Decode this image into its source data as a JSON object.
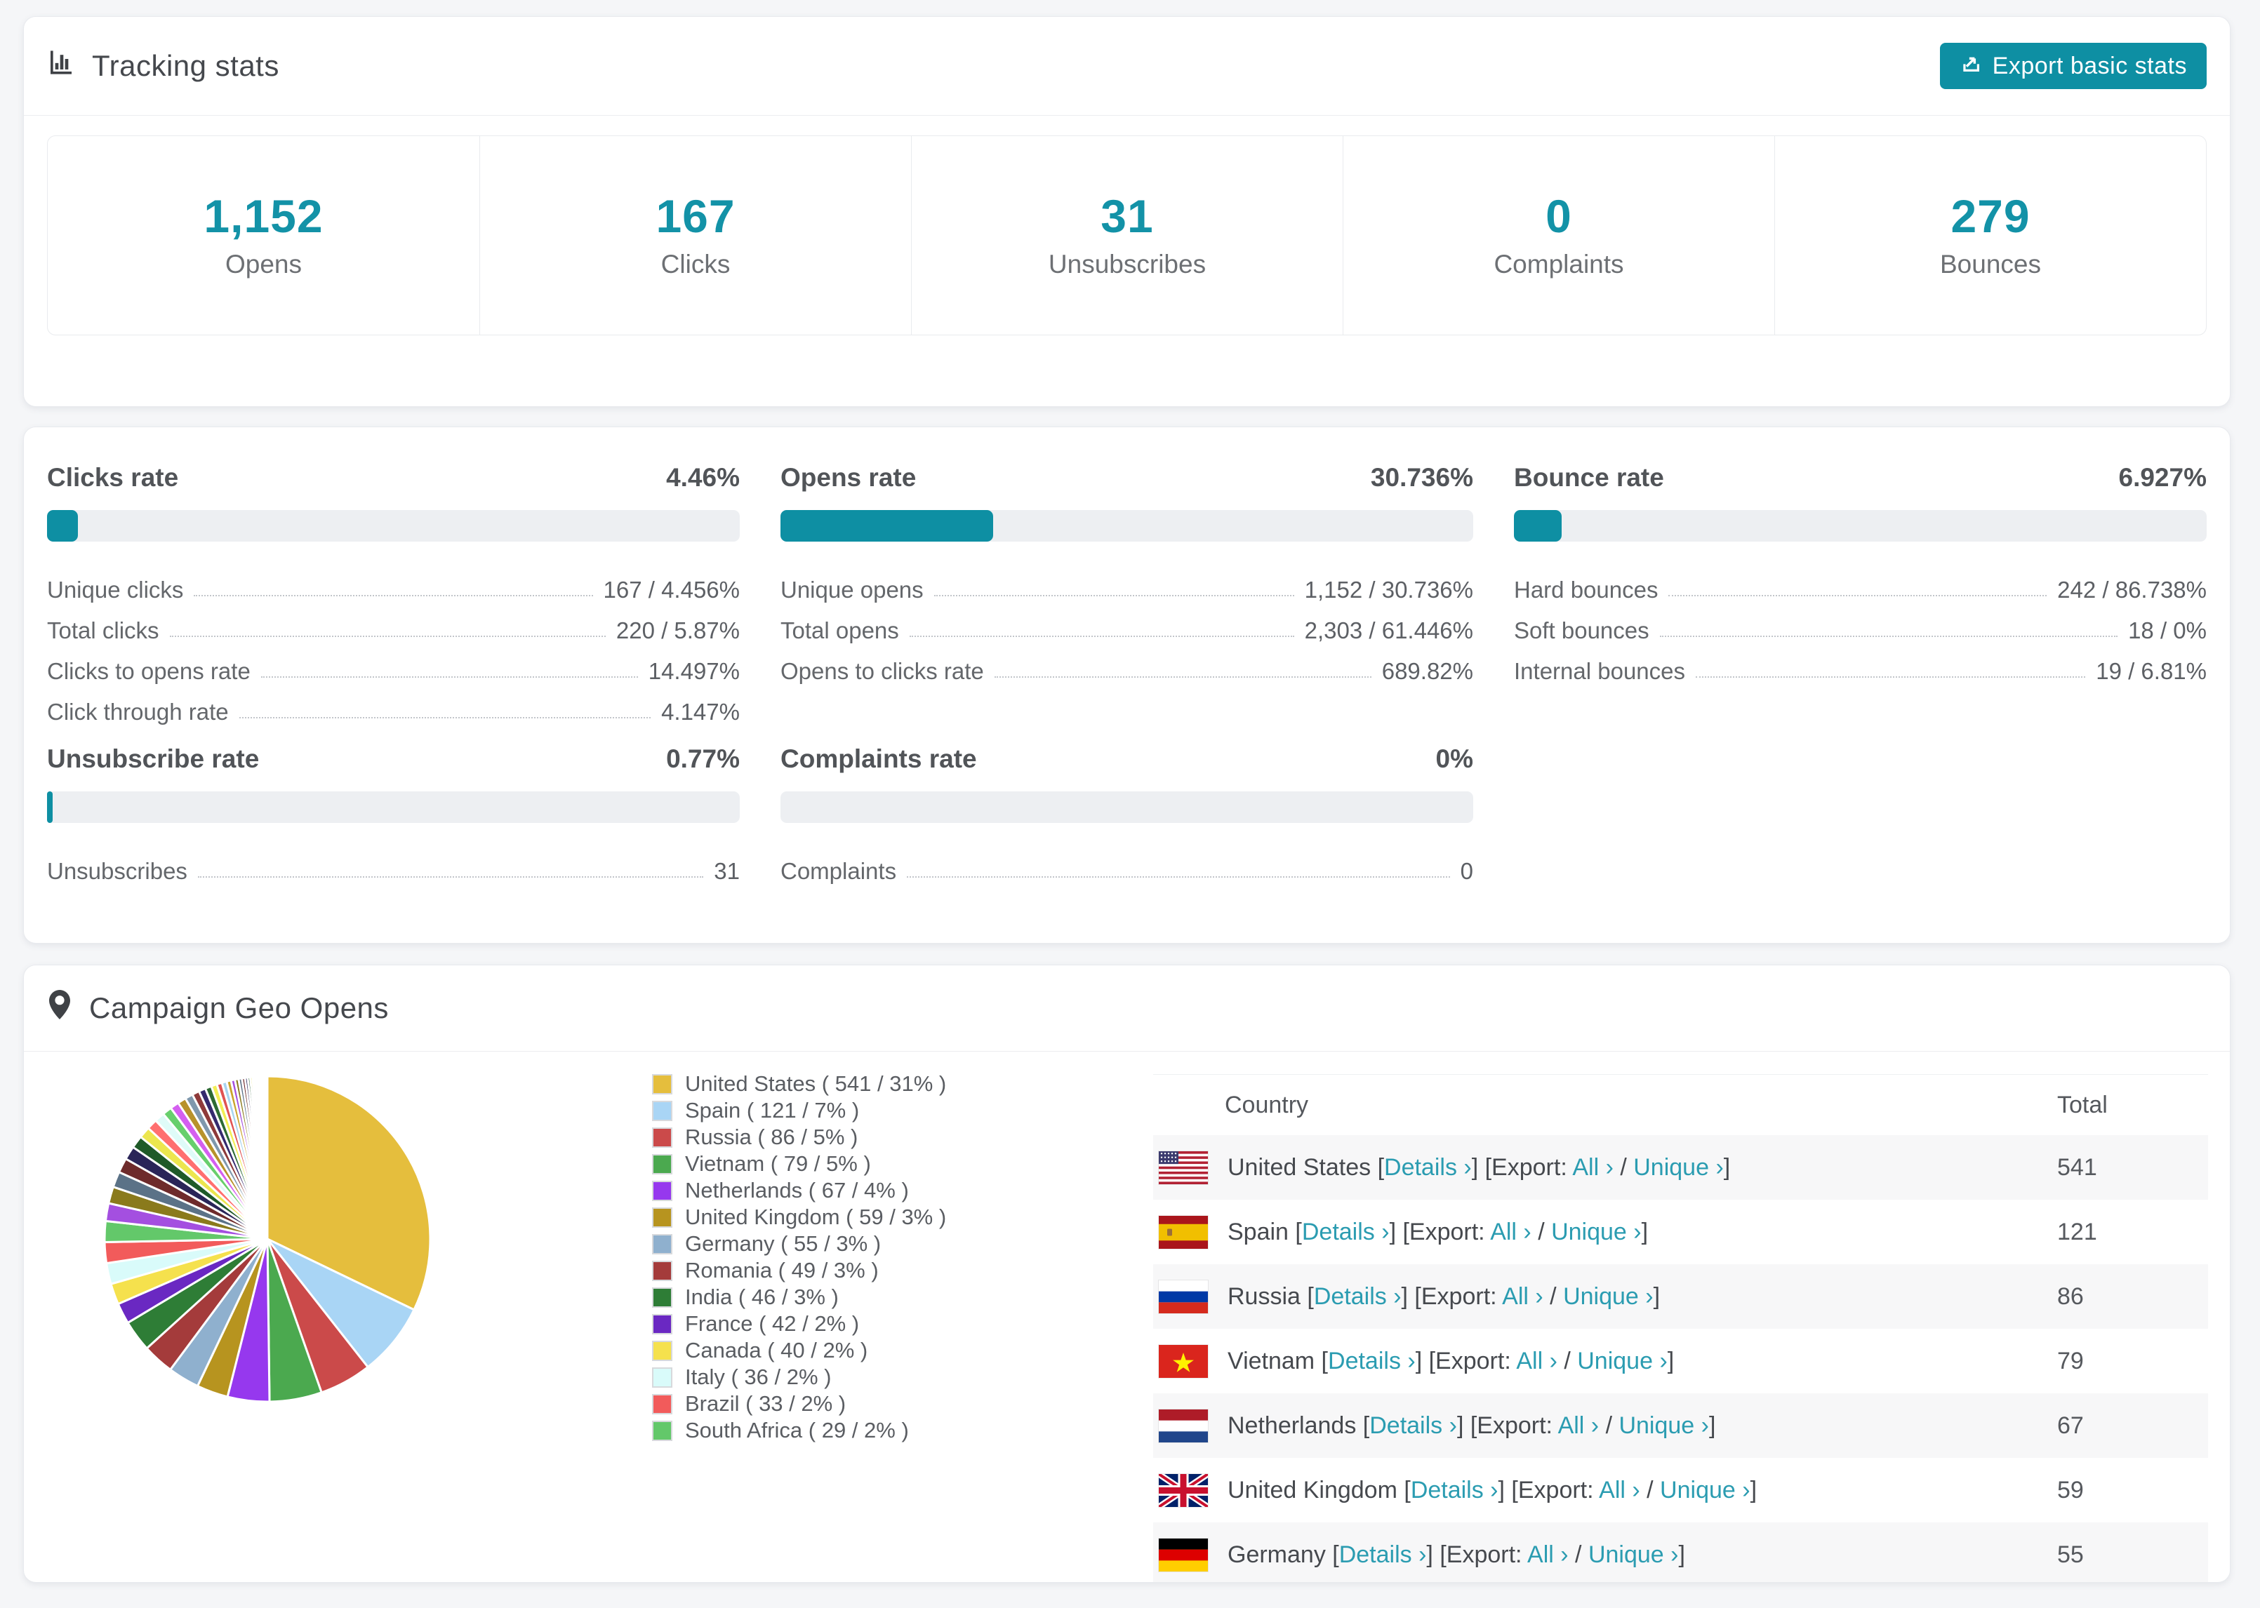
{
  "page": {
    "background": "#f5f6f8"
  },
  "colors": {
    "accent": "#0e8fa3",
    "stat_number": "#1392a7",
    "link": "#2b9cb1",
    "bar_track": "#edeff2",
    "card_border": "#e8eaee"
  },
  "tracking": {
    "title": "Tracking stats",
    "export_label": "Export basic stats",
    "summary": [
      {
        "value": "1,152",
        "label": "Opens"
      },
      {
        "value": "167",
        "label": "Clicks"
      },
      {
        "value": "31",
        "label": "Unsubscribes"
      },
      {
        "value": "0",
        "label": "Complaints"
      },
      {
        "value": "279",
        "label": "Bounces"
      }
    ]
  },
  "rates": [
    {
      "title": "Clicks rate",
      "percent": "4.46%",
      "bar_percent": 4.46,
      "rows": [
        {
          "label": "Unique clicks",
          "value": "167 / 4.456%"
        },
        {
          "label": "Total clicks",
          "value": "220 / 5.87%"
        },
        {
          "label": "Clicks to opens rate",
          "value": "14.497%"
        },
        {
          "label": "Click through rate",
          "value": "4.147%"
        }
      ]
    },
    {
      "title": "Opens rate",
      "percent": "30.736%",
      "bar_percent": 30.736,
      "rows": [
        {
          "label": "Unique opens",
          "value": "1,152 / 30.736%"
        },
        {
          "label": "Total opens",
          "value": "2,303 / 61.446%"
        },
        {
          "label": "Opens to clicks rate",
          "value": "689.82%"
        }
      ]
    },
    {
      "title": "Bounce rate",
      "percent": "6.927%",
      "bar_percent": 6.927,
      "rows": [
        {
          "label": "Hard bounces",
          "value": "242 / 86.738%"
        },
        {
          "label": "Soft bounces",
          "value": "18 / 0%"
        },
        {
          "label": "Internal bounces",
          "value": "19 / 6.81%"
        }
      ]
    },
    {
      "title": "Unsubscribe rate",
      "percent": "0.77%",
      "bar_percent": 0.77,
      "rows": [
        {
          "label": "Unsubscribes",
          "value": "31"
        }
      ]
    },
    {
      "title": "Complaints rate",
      "percent": "0%",
      "bar_percent": 0,
      "rows": [
        {
          "label": "Complaints",
          "value": "0"
        }
      ]
    }
  ],
  "geo": {
    "title": "Campaign Geo Opens",
    "chart_data": {
      "type": "pie",
      "title": "Campaign Geo Opens",
      "legend_position": "right",
      "start_angle_deg": -90,
      "direction": "clockwise",
      "slices": [
        {
          "label": "United States",
          "count": 541,
          "pct": 31,
          "color": "#E5BE3D"
        },
        {
          "label": "Spain",
          "count": 121,
          "pct": 7,
          "color": "#A9D5F5"
        },
        {
          "label": "Russia",
          "count": 86,
          "pct": 5,
          "color": "#CB4A4A"
        },
        {
          "label": "Vietnam",
          "count": 79,
          "pct": 5,
          "color": "#4BA94F"
        },
        {
          "label": "Netherlands",
          "count": 67,
          "pct": 4,
          "color": "#9638EE"
        },
        {
          "label": "United Kingdom",
          "count": 59,
          "pct": 3,
          "color": "#B7941F"
        },
        {
          "label": "Germany",
          "count": 55,
          "pct": 3,
          "color": "#8FB0CE"
        },
        {
          "label": "Romania",
          "count": 49,
          "pct": 3,
          "color": "#A43B3B"
        },
        {
          "label": "India",
          "count": 46,
          "pct": 3,
          "color": "#2E7D36"
        },
        {
          "label": "France",
          "count": 42,
          "pct": 2,
          "color": "#6A28C2"
        },
        {
          "label": "Canada",
          "count": 40,
          "pct": 2,
          "color": "#F5E14D"
        },
        {
          "label": "Italy",
          "count": 36,
          "pct": 2,
          "color": "#D9FBFA"
        },
        {
          "label": "Brazil",
          "count": 33,
          "pct": 2,
          "color": "#F25B5B"
        },
        {
          "label": "South Africa",
          "count": 29,
          "pct": 2,
          "color": "#63C86A"
        }
      ],
      "other_slices_percents": [
        1.7,
        1.6,
        1.5,
        1.4,
        1.3,
        1.2,
        1.1,
        1.0,
        0.95,
        0.9,
        0.85,
        0.8,
        0.75,
        0.7,
        0.65,
        0.6,
        0.55,
        0.5,
        0.46,
        0.42,
        0.38,
        0.35,
        0.32,
        0.29,
        0.26,
        0.24,
        0.22,
        0.2,
        0.18,
        0.16,
        0.14,
        0.12,
        0.11,
        0.1,
        0.09,
        0.08,
        0.07,
        0.06,
        0.05,
        0.05
      ],
      "other_slices_palette": [
        "#A44FE0",
        "#8A7A1C",
        "#5B7287",
        "#6E2B2B",
        "#2A2558",
        "#1F5A28",
        "#ECE64E",
        "#FF6F6F",
        "#DFFBF8",
        "#67CF6C",
        "#D45FF0",
        "#B8922B",
        "#7F98AD",
        "#8E3A3A",
        "#352A6E",
        "#2D6A33",
        "#F2EE55",
        "#E05252",
        "#A8D4F0",
        "#CAA32B"
      ]
    },
    "legend_format": "{label} ( {count} / {pct}% )",
    "table": {
      "headers": [
        "Country",
        "Total"
      ],
      "link_labels": {
        "details": "Details",
        "export_prefix": "Export:",
        "all": "All",
        "unique": "Unique",
        "chevron": "›"
      },
      "rows": [
        {
          "country": "United States",
          "flag": "us",
          "total": "541"
        },
        {
          "country": "Spain",
          "flag": "es",
          "total": "121"
        },
        {
          "country": "Russia",
          "flag": "ru",
          "total": "86"
        },
        {
          "country": "Vietnam",
          "flag": "vn",
          "total": "79"
        },
        {
          "country": "Netherlands",
          "flag": "nl",
          "total": "67"
        },
        {
          "country": "United Kingdom",
          "flag": "gb",
          "total": "59"
        },
        {
          "country": "Germany",
          "flag": "de",
          "total": "55"
        }
      ]
    }
  }
}
